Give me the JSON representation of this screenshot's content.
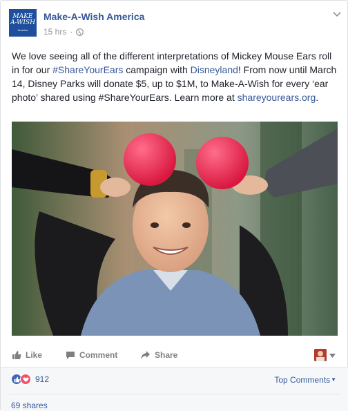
{
  "post": {
    "page_name": "Make-A-Wish America",
    "time": "15 hrs",
    "separator": "·",
    "privacy_icon": "globe-icon",
    "avatar": {
      "logo_line1": "MAKE",
      "logo_line2": "A-WISH",
      "logo_sub": "America",
      "brand_color": "#1f4f9c"
    },
    "text": {
      "p1": "We love seeing all of the different interpretations of Mickey Mouse Ears roll in for our ",
      "hashtag1": "#ShareYourEars",
      "p2": " campaign with ",
      "mention": "Disneyland",
      "p3": "! From now until March 14, Disney Parks will donate $5, up to $1M, to Make-A-Wish for every ‘ear photo’ shared using #ShareYourEars. Learn more at ",
      "link": "shareyourears.org",
      "p4": "."
    },
    "image_description_icon": "photo-boy-with-mickey-ears"
  },
  "actions": {
    "like": "Like",
    "comment": "Comment",
    "share": "Share"
  },
  "summary": {
    "reaction_count": "912",
    "reaction_icons": [
      "like-icon",
      "love-icon"
    ],
    "top_comments": "Top Comments",
    "shares": "69 shares"
  },
  "colors": {
    "link": "#365899",
    "meta": "#90949c",
    "like_blue": "#4267b2",
    "love_red": "#f25268",
    "action_gray": "#7f7f7f"
  }
}
